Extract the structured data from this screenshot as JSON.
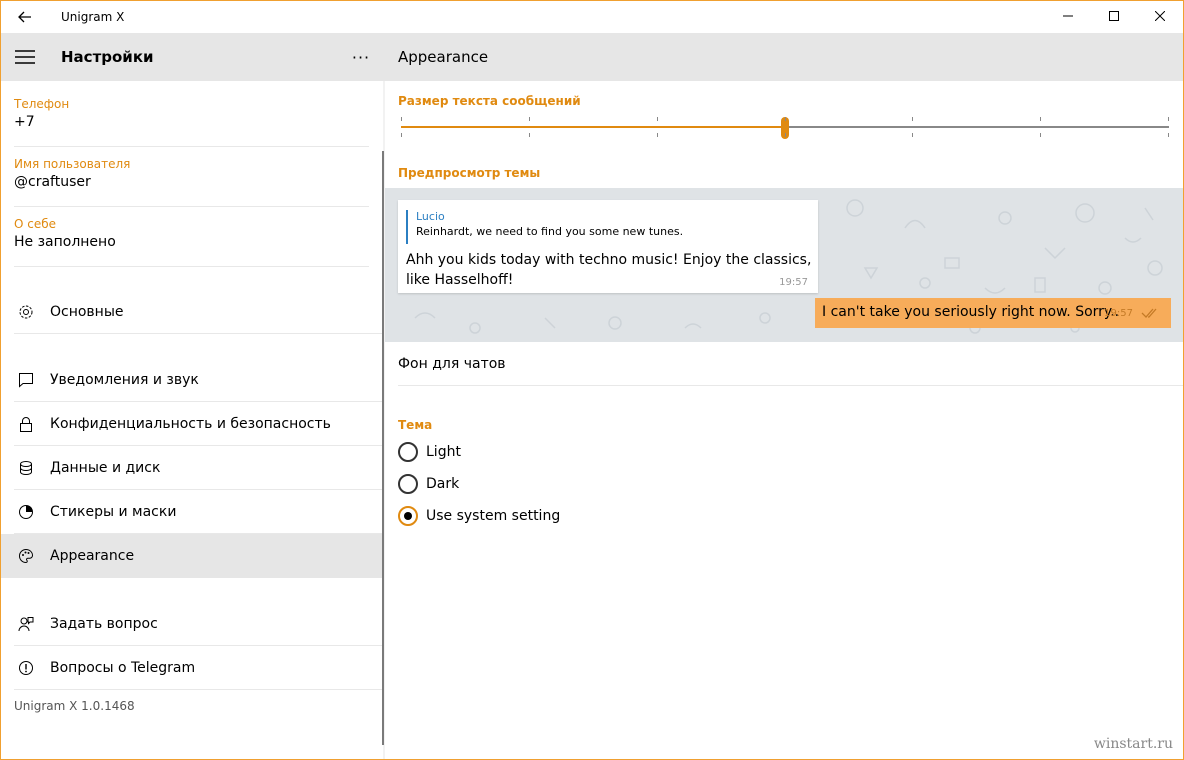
{
  "window": {
    "title": "Unigram X"
  },
  "left": {
    "header_title": "Настройки",
    "profile": {
      "phone_label": "Телефон",
      "phone_value": "+7",
      "username_label": "Имя пользователя",
      "username_value": "@craftuser",
      "about_label": "О себе",
      "about_value": "Не заполнено"
    },
    "nav": [
      {
        "label": "Основные",
        "icon": "gear-icon"
      },
      {
        "label": "Уведомления и звук",
        "icon": "chat-bubble-icon"
      },
      {
        "label": "Конфиденциальность и безопасность",
        "icon": "lock-icon"
      },
      {
        "label": "Данные и диск",
        "icon": "database-icon"
      },
      {
        "label": "Стикеры и маски",
        "icon": "pie-icon"
      },
      {
        "label": "Appearance",
        "icon": "palette-icon",
        "selected": true
      },
      {
        "label": "Задать вопрос",
        "icon": "ask-question-icon"
      },
      {
        "label": "Вопросы о Telegram",
        "icon": "info-icon"
      }
    ],
    "version": "Unigram X 1.0.1468"
  },
  "right": {
    "header_title": "Appearance",
    "text_size": {
      "label": "Размер текста сообщений",
      "value_fraction": 0.5
    },
    "preview": {
      "label": "Предпросмотр темы",
      "reply_name": "Lucio",
      "reply_text": "Reinhardt, we need to find you some new tunes.",
      "incoming_text": "Ahh you kids today with techno music! Enjoy the classics, like Hasselhoff!",
      "incoming_time": "19:57",
      "outgoing_text": "I can't take you seriously right now. Sorry..",
      "outgoing_time": "19:57"
    },
    "chat_background": "Фон для чатов",
    "theme": {
      "label": "Тема",
      "options": [
        "Light",
        "Dark",
        "Use system setting"
      ],
      "selected": "Use system setting"
    },
    "watermark": "winstart.ru"
  },
  "colors": {
    "accent": "#e08a10",
    "outgoing_bubble": "#f7ac5a",
    "reply_blue": "#2b7fc2"
  }
}
